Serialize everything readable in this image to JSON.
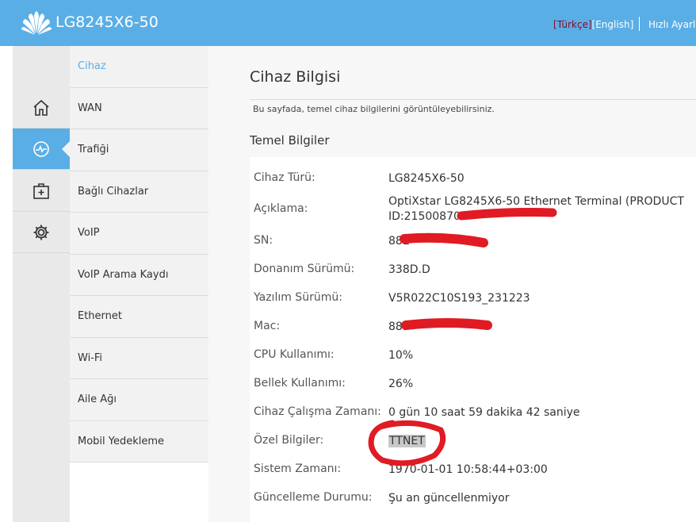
{
  "header": {
    "model": "LG8245X6-50",
    "lang_turkish": "Türkçe",
    "lang_english": "English",
    "quick_setup": "Hızlı Ayarl"
  },
  "icon_nav": [
    {
      "icon": "home-icon"
    },
    {
      "icon": "monitor-icon",
      "active": true
    },
    {
      "icon": "add-box-icon"
    },
    {
      "icon": "gear-icon"
    }
  ],
  "submenu": [
    {
      "label": "Cihaz",
      "active": true
    },
    {
      "label": "WAN"
    },
    {
      "label": "Trafiği"
    },
    {
      "label": "Bağlı Cihazlar"
    },
    {
      "label": "VoIP"
    },
    {
      "label": "VoIP Arama Kaydı"
    },
    {
      "label": "Ethernet"
    },
    {
      "label": "Wi-Fi"
    },
    {
      "label": "Aile Ağı"
    },
    {
      "label": "Mobil Yedekleme"
    }
  ],
  "content": {
    "title": "Cihaz Bilgisi",
    "description": "Bu sayfada, temel cihaz bilgilerini görüntüleyebilirsiniz.",
    "section": "Temel Bilgiler",
    "rows": [
      {
        "label": "Cihaz Türü:",
        "value": "LG8245X6-50"
      },
      {
        "label": "Açıklama:",
        "value": "OptiXstar LG8245X6-50 Ethernet Terminal (PRODUCT ID:215008707"
      },
      {
        "label": "SN:",
        "value": "88E"
      },
      {
        "label": "Donanım Sürümü:",
        "value": "338D.D"
      },
      {
        "label": "Yazılım Sürümü:",
        "value": "V5R022C10S193_231223"
      },
      {
        "label": "Mac:",
        "value": "88:"
      },
      {
        "label": "CPU Kullanımı:",
        "value": "10%"
      },
      {
        "label": "Bellek Kullanımı:",
        "value": "26%"
      },
      {
        "label": "Cihaz Çalışma Zamanı:",
        "value": "0 gün 10 saat 59 dakika 42 saniye"
      },
      {
        "label": "Özel Bilgiler:",
        "value": "TTNET"
      },
      {
        "label": "Sistem Zamanı:",
        "value": "1970-01-01 10:58:44+03:00"
      },
      {
        "label": "Güncelleme Durumu:",
        "value": "Şu an güncellenmiyor"
      }
    ]
  },
  "colors": {
    "header_bg": "#5aaee6",
    "active_menu": "#5aaee6",
    "annotation_red": "#e01b24"
  }
}
